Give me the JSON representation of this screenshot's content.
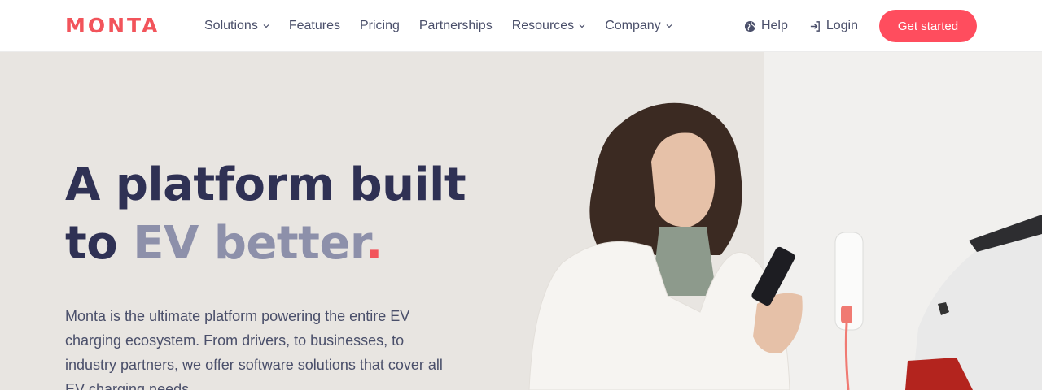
{
  "brand": {
    "logo_text": "MONTA",
    "accent": "#f2545b",
    "cta_color": "#ff4d5e",
    "text_dark": "#2f3154"
  },
  "nav": {
    "items": [
      {
        "label": "Solutions",
        "dropdown": true
      },
      {
        "label": "Features",
        "dropdown": false
      },
      {
        "label": "Pricing",
        "dropdown": false
      },
      {
        "label": "Partnerships",
        "dropdown": false
      },
      {
        "label": "Resources",
        "dropdown": true
      },
      {
        "label": "Company",
        "dropdown": true
      }
    ],
    "help_label": "Help",
    "help_icon": "globe-icon",
    "login_label": "Login",
    "login_icon": "login-icon",
    "cta_label": "Get started"
  },
  "hero": {
    "headline_line1": "A platform built",
    "headline_line2_prefix": "to",
    "headline_accent": "EV better",
    "headline_dot": ".",
    "subtext": "Monta is the ultimate platform powering the entire EV charging ecosystem. From drivers, to businesses, to industry partners, we offer software solutions that cover all EV charging needs."
  }
}
